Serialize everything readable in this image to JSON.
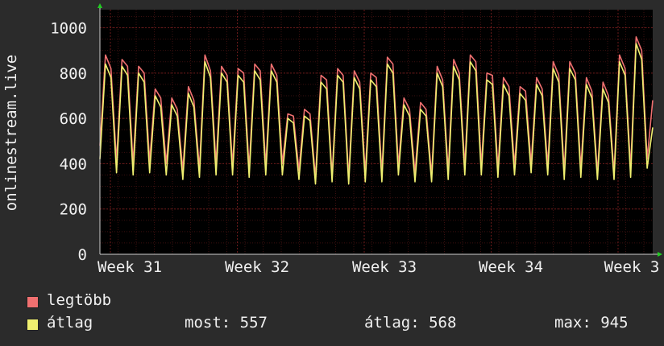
{
  "chart_data": {
    "type": "line",
    "ylabel": "onlinestream.live",
    "ylim": [
      0,
      1080
    ],
    "y_ticks": [
      0,
      200,
      400,
      600,
      800,
      1000
    ],
    "x_ticks": [
      "Week 31",
      "Week 32",
      "Week 33",
      "Week 34",
      "Week 3"
    ],
    "grid": true,
    "background": "#000000",
    "grid_color": "#4a1010",
    "series": [
      {
        "name": "legtöbb",
        "color": "#f07070",
        "values": [
          480,
          880,
          820,
          410,
          860,
          830,
          400,
          830,
          800,
          410,
          730,
          690,
          400,
          690,
          640,
          370,
          740,
          680,
          380,
          880,
          810,
          400,
          830,
          790,
          390,
          820,
          800,
          380,
          840,
          810,
          390,
          840,
          790,
          400,
          620,
          610,
          370,
          640,
          620,
          340,
          790,
          770,
          350,
          820,
          790,
          340,
          810,
          760,
          360,
          800,
          780,
          360,
          870,
          840,
          390,
          690,
          640,
          360,
          670,
          640,
          350,
          830,
          770,
          370,
          860,
          800,
          390,
          880,
          850,
          390,
          800,
          790,
          380,
          780,
          740,
          390,
          740,
          720,
          400,
          780,
          730,
          390,
          850,
          790,
          370,
          850,
          800,
          380,
          780,
          720,
          360,
          760,
          700,
          360,
          880,
          820,
          380,
          960,
          900,
          420,
          680
        ],
        "current": 557,
        "average": 568,
        "max": 945
      },
      {
        "name": "átlag",
        "color": "#f0f070",
        "values": [
          420,
          840,
          780,
          360,
          830,
          790,
          350,
          800,
          760,
          360,
          700,
          650,
          350,
          660,
          610,
          330,
          710,
          650,
          340,
          850,
          780,
          350,
          800,
          760,
          350,
          790,
          760,
          340,
          810,
          770,
          350,
          810,
          760,
          350,
          600,
          580,
          330,
          610,
          590,
          310,
          760,
          730,
          320,
          790,
          760,
          310,
          780,
          730,
          320,
          770,
          740,
          320,
          840,
          800,
          350,
          660,
          610,
          320,
          640,
          610,
          320,
          800,
          740,
          330,
          830,
          770,
          350,
          850,
          810,
          350,
          770,
          750,
          340,
          750,
          700,
          350,
          710,
          680,
          360,
          750,
          700,
          350,
          820,
          760,
          330,
          820,
          770,
          340,
          750,
          690,
          330,
          730,
          670,
          330,
          850,
          790,
          340,
          930,
          860,
          380,
          560
        ]
      }
    ]
  },
  "legend": {
    "max_label": "legtöbb",
    "avg_label": "átlag",
    "now_text": "most: 557",
    "avg_text": "átlag: 568",
    "max_text": "max: 945"
  }
}
